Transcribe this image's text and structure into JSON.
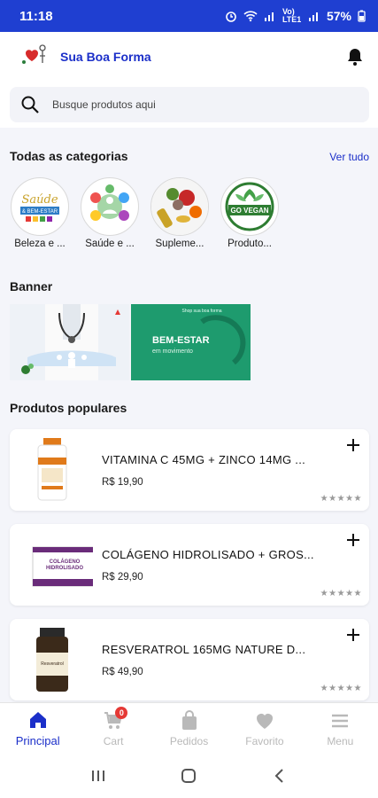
{
  "status_bar": {
    "time": "11:18",
    "network": "Vo) LTE1",
    "battery": "57%"
  },
  "app": {
    "title": "Sua Boa Forma"
  },
  "search": {
    "placeholder": "Busque produtos aqui"
  },
  "categories": {
    "title": "Todas as categorias",
    "see_all": "Ver tudo",
    "items": [
      {
        "label": "Beleza e ..."
      },
      {
        "label": "Saúde e ..."
      },
      {
        "label": "Suplеme..."
      },
      {
        "label": "Produto..."
      }
    ],
    "image_text": {
      "beauty": [
        "Saúde",
        "& BEM-ESTAR"
      ],
      "vegan": "GO VEGAN"
    }
  },
  "banner": {
    "title": "Banner",
    "slide_text": {
      "brand": "Shop sua boa forma",
      "headline": "BEM-ESTAR",
      "sub": "em movimento"
    }
  },
  "popular": {
    "title": "Produtos populares",
    "products": [
      {
        "name": "VITAMINA C 45MG + ZINCO 14MG ...",
        "price": "R$ 19,90",
        "rating_stars": "★★★★★",
        "rating": 0
      },
      {
        "name": "COLÁGENO HIDROLISADO + GROS...",
        "price": "R$ 29,90",
        "rating_stars": "★★★★★",
        "rating": 0
      },
      {
        "name": "RESVERATROL 165MG NATURE D...",
        "price": "R$ 49,90",
        "rating_stars": "★★★★★",
        "rating": 0
      }
    ],
    "package_text": {
      "colageno": [
        "COLÁGENO",
        "HIDROLISADO"
      ],
      "resveratrol": "Resveratrol"
    }
  },
  "bottom_nav": {
    "items": [
      {
        "label": "Principal",
        "icon": "home-icon",
        "active": true
      },
      {
        "label": "Cart",
        "icon": "cart-icon",
        "badge": "0"
      },
      {
        "label": "Pedidos",
        "icon": "bag-icon"
      },
      {
        "label": "Favorito",
        "icon": "heart-icon"
      },
      {
        "label": "Menu",
        "icon": "menu-icon"
      }
    ]
  },
  "colors": {
    "brand_blue": "#1f3fd1",
    "accent_blue": "#1b2fc9",
    "badge_red": "#e53935",
    "banner_green": "#1e9b6e"
  }
}
